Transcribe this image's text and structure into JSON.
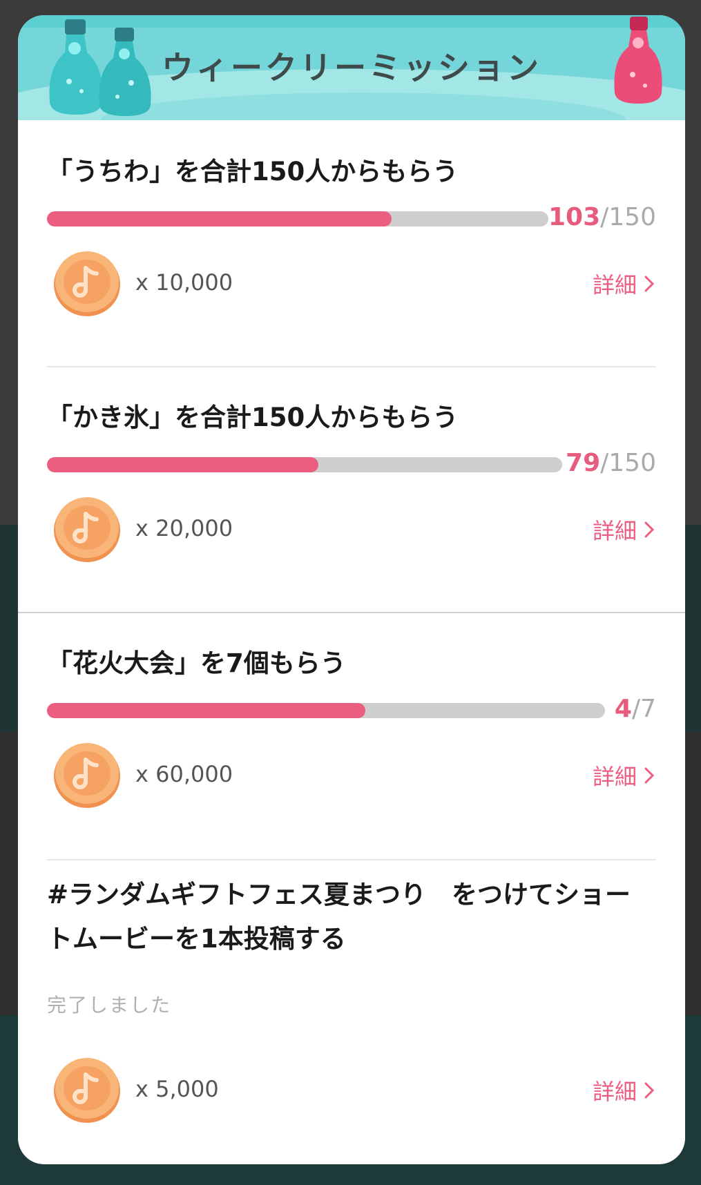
{
  "header": {
    "title": "ウィークリーミッション"
  },
  "missions": [
    {
      "title": "「うちわ」を合計150人からもらう",
      "progress": {
        "current": "103",
        "separator": "/",
        "total": "150",
        "fraction": 0.687
      },
      "reward": "x 10,000",
      "detail_label": "詳細"
    },
    {
      "title": "「かき氷」を合計150人からもらう",
      "progress": {
        "current": "79",
        "separator": "/",
        "total": "150",
        "fraction": 0.527
      },
      "reward": "x 20,000",
      "detail_label": "詳細"
    },
    {
      "title": "「花火大会」を7個もらう",
      "progress": {
        "current": "4",
        "separator": "/",
        "total": "7",
        "fraction": 0.571
      },
      "reward": "x 60,000",
      "detail_label": "詳細"
    },
    {
      "title": "#ランダムギフトフェス夏まつり　をつけてショートムービーを1本投稿する",
      "status": "完了しました",
      "reward": "x 5,000",
      "detail_label": "詳細"
    }
  ],
  "colors": {
    "accent": "#ec5e80",
    "track": "#cfcfcf",
    "header_bg": "#74d6d9",
    "coin": "#f7a867"
  },
  "icons": [
    "coin-icon",
    "chevron-right-icon",
    "bottle-icon"
  ]
}
